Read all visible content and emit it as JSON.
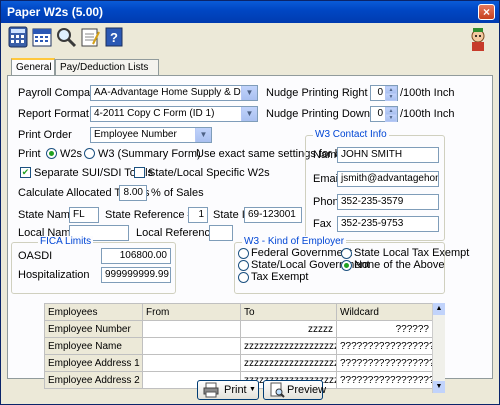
{
  "window": {
    "title": "Paper W2s (5.00)",
    "close_label": "×"
  },
  "toolbar": {
    "icons": [
      "calculator-icon",
      "calendar-icon",
      "magnifier-icon",
      "notepad-icon",
      "help-book-icon"
    ]
  },
  "tabs": [
    {
      "label": "General"
    },
    {
      "label": "Pay/Deduction Lists"
    }
  ],
  "general": {
    "payroll_company_label": "Payroll Company",
    "payroll_company_value": "AA-Advantage Home Supply & Decor",
    "report_format_label": "Report Format",
    "report_format_value": "4-2011 Copy C Form (ID 1)",
    "print_order_label": "Print Order",
    "print_order_value": "Employee Number",
    "nudge_right_label": "Nudge Printing Right",
    "nudge_right_value": "0",
    "nudge_down_label": "Nudge Printing Down",
    "nudge_down_value": "0",
    "nudge_unit": "/100th Inch",
    "print_label": "Print",
    "print_opt_w2": "W2s",
    "print_opt_w3": "W3 (Summary Form)",
    "print_note": "Use exact same settings for both!",
    "separate_sui_label": "Separate SUI/SDI Totals",
    "separate_sui_checked": true,
    "state_local_label": "State/Local Specific W2s",
    "state_local_checked": false,
    "alloc_tips_label": "Calculate Allocated Tips as",
    "alloc_tips_value": "8.00",
    "alloc_tips_suffix": "% of Sales",
    "state_name_label": "State Name",
    "state_name_value": "FL",
    "state_ref_label": "State Reference #",
    "state_ref_value": "1",
    "state_id_label": "State ID",
    "state_id_value": "69-123001",
    "local_name_label": "Local Name",
    "local_name_value": "",
    "local_ref_label": "Local Reference #",
    "local_ref_value": ""
  },
  "w3_contact": {
    "title": "W3 Contact Info",
    "name_label": "Name",
    "name_value": "JOHN SMITH",
    "email_label": "Email",
    "email_value": "jsmith@advantagehome.c",
    "phone_label": "Phone",
    "phone_value": "352-235-3579",
    "fax_label": "Fax",
    "fax_value": "352-235-9753"
  },
  "fica": {
    "title": "FICA Limits",
    "oasdi_label": "OASDI",
    "oasdi_value": "106800.00",
    "hosp_label": "Hospitalization",
    "hosp_value": "999999999.99"
  },
  "w3_kind": {
    "title": "W3 - Kind of Employer",
    "opt_federal": "Federal Government",
    "opt_state_local_exempt": "State  Local Tax Exempt",
    "opt_state_local_gov": "State/Local Government",
    "opt_none": "None of the Above",
    "opt_tax_exempt": "Tax Exempt",
    "selected": "opt_none"
  },
  "grid": {
    "headers": [
      "Employees",
      "From",
      "To",
      "Wildcard"
    ],
    "rows": [
      [
        "Employee Number",
        "",
        "zzzzz",
        "??????"
      ],
      [
        "Employee Name",
        "",
        "zzzzzzzzzzzzzzzzzzzzzz",
        "????????????????????"
      ],
      [
        "Employee Address 1",
        "",
        "zzzzzzzzzzzzzzzzzzzzzz",
        "????????????????????"
      ],
      [
        "Employee Address 2",
        "",
        "zzzzzzzzzzzzzzzzzzzzzz",
        "????????????????????"
      ]
    ]
  },
  "buttons": {
    "print": "Print",
    "preview": "Preview"
  }
}
